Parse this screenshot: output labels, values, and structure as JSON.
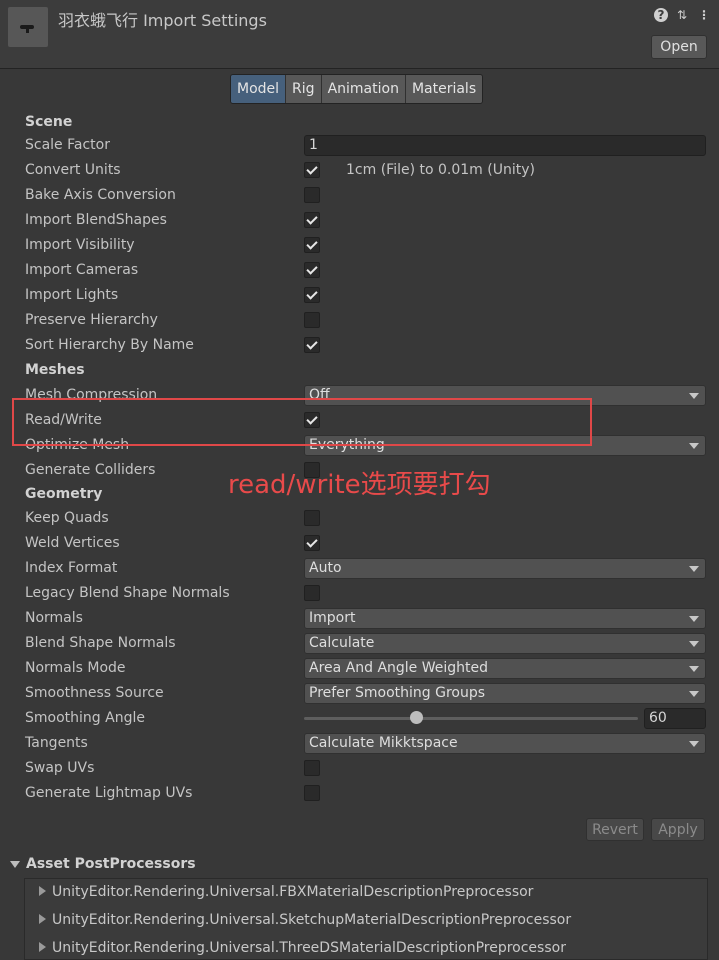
{
  "header": {
    "title": "羽衣蛾飞行 Import Settings",
    "open_label": "Open"
  },
  "tabs": [
    "Model",
    "Rig",
    "Animation",
    "Materials"
  ],
  "scene": {
    "heading": "Scene",
    "scale_factor_label": "Scale Factor",
    "scale_factor_value": "1",
    "convert_units_label": "Convert Units",
    "convert_units_text": "1cm (File) to 0.01m (Unity)",
    "bake_axis_label": "Bake Axis Conversion",
    "import_blendshapes_label": "Import BlendShapes",
    "import_visibility_label": "Import Visibility",
    "import_cameras_label": "Import Cameras",
    "import_lights_label": "Import Lights",
    "preserve_hierarchy_label": "Preserve Hierarchy",
    "sort_hierarchy_label": "Sort Hierarchy By Name"
  },
  "meshes": {
    "heading": "Meshes",
    "mesh_compression_label": "Mesh Compression",
    "mesh_compression_value": "Off",
    "read_write_label": "Read/Write",
    "optimize_mesh_label": "Optimize Mesh",
    "optimize_mesh_value": "Everything",
    "generate_colliders_label": "Generate Colliders"
  },
  "geometry": {
    "heading": "Geometry",
    "keep_quads_label": "Keep Quads",
    "weld_vertices_label": "Weld Vertices",
    "index_format_label": "Index Format",
    "index_format_value": "Auto",
    "legacy_blend_label": "Legacy Blend Shape Normals",
    "normals_label": "Normals",
    "normals_value": "Import",
    "blend_shape_normals_label": "Blend Shape Normals",
    "blend_shape_normals_value": "Calculate",
    "normals_mode_label": "Normals Mode",
    "normals_mode_value": "Area And Angle Weighted",
    "smoothness_source_label": "Smoothness Source",
    "smoothness_source_value": "Prefer Smoothing Groups",
    "smoothing_angle_label": "Smoothing Angle",
    "smoothing_angle_value": "60",
    "tangents_label": "Tangents",
    "tangents_value": "Calculate Mikktspace",
    "swap_uvs_label": "Swap UVs",
    "generate_lightmap_label": "Generate Lightmap UVs"
  },
  "actions": {
    "revert_label": "Revert",
    "apply_label": "Apply"
  },
  "postprocessors": {
    "heading": "Asset PostProcessors",
    "items": [
      "UnityEditor.Rendering.Universal.FBXMaterialDescriptionPreprocessor",
      "UnityEditor.Rendering.Universal.SketchupMaterialDescriptionPreprocessor",
      "UnityEditor.Rendering.Universal.ThreeDSMaterialDescriptionPreprocessor"
    ]
  },
  "annotation": {
    "text": "read/write选项要打勾",
    "color": "#e84a4a"
  },
  "colors": {
    "active_tab": "#46607c",
    "background": "#383838"
  }
}
